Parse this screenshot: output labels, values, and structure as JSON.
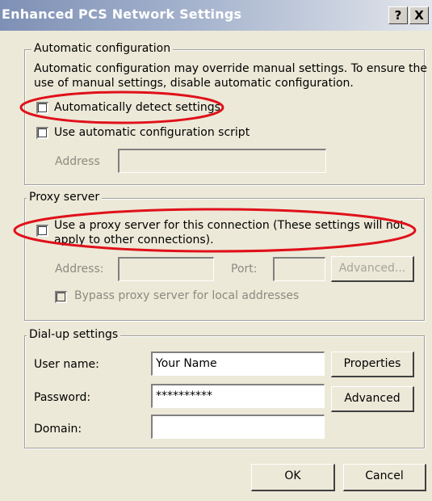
{
  "window": {
    "title": "Enhanced PCS Network Settings",
    "help_button": "?",
    "close_button": "X"
  },
  "auto_config": {
    "legend": "Automatic configuration",
    "description_line1": "Automatic configuration may override manual settings.  To ensure the",
    "description_line2": "use of manual settings, disable automatic configuration.",
    "detect_label": "Automatically detect settings",
    "detect_checked": false,
    "script_label": "Use automatic configuration script",
    "script_checked": false,
    "address_label": "Address",
    "address_value": ""
  },
  "proxy": {
    "legend": "Proxy server",
    "use_proxy_line1": "Use a proxy server for this connection (These settings will not",
    "use_proxy_line2": "apply to other connections).",
    "use_proxy_checked": false,
    "address_label": "Address:",
    "address_value": "",
    "port_label": "Port:",
    "port_value": "",
    "advanced_button": "Advanced...",
    "bypass_label": "Bypass proxy server for local addresses",
    "bypass_checked": false
  },
  "dialup": {
    "legend": "Dial-up settings",
    "username_label": "User name:",
    "username_value": "Your Name",
    "password_label": "Password:",
    "password_value": "**********",
    "domain_label": "Domain:",
    "domain_value": "",
    "properties_button": "Properties",
    "advanced_button": "Advanced"
  },
  "footer": {
    "ok_button": "OK",
    "cancel_button": "Cancel"
  },
  "colors": {
    "dialog_bg": "#ece9d8",
    "annotation": "#e0101a"
  }
}
